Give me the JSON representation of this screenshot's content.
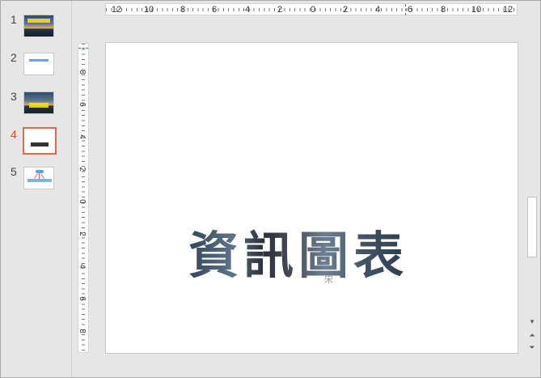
{
  "slides": [
    {
      "number": "1"
    },
    {
      "number": "2"
    },
    {
      "number": "3"
    },
    {
      "number": "4",
      "active": true
    },
    {
      "number": "5"
    }
  ],
  "ruler_h": [
    "12",
    "10",
    "8",
    "6",
    "4",
    "2",
    "0",
    "2",
    "4",
    "6",
    "8",
    "10",
    "12"
  ],
  "ruler_v": [
    "8",
    "6",
    "4",
    "2",
    "0",
    "2",
    "4",
    "6",
    "8"
  ],
  "slide": {
    "title": "資訊圖表",
    "watermark": "宋"
  },
  "scroll": {
    "down_arrow": "▾",
    "prev_slide": "⏶",
    "next_slide": "⏷"
  },
  "colors": {
    "active_slide": "#e0694a",
    "accent_number": "#d2502e"
  }
}
